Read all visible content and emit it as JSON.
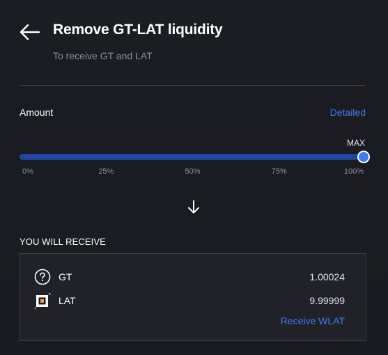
{
  "header": {
    "title": "Remove GT-LAT liquidity",
    "subtitle": "To receive GT and LAT",
    "back_icon": "arrow-left-icon"
  },
  "amount": {
    "label": "Amount",
    "detailed_link": "Detailed",
    "max_label": "MAX",
    "slider_percent": 100,
    "ticks": [
      "0%",
      "25%",
      "50%",
      "75%",
      "100%"
    ]
  },
  "receive": {
    "heading": "YOU WILL RECEIVE",
    "tokens": [
      {
        "symbol": "GT",
        "amount": "1.00024",
        "icon": "question-circle-icon"
      },
      {
        "symbol": "LAT",
        "amount": "9.99999",
        "icon": "lat-token-icon"
      }
    ],
    "wrap_link": "Receive WLAT"
  },
  "colors": {
    "background": "#1a1c21",
    "accent": "#3b7bf6",
    "slider_fill": "#1f45a6",
    "muted_text": "#8d9099"
  }
}
